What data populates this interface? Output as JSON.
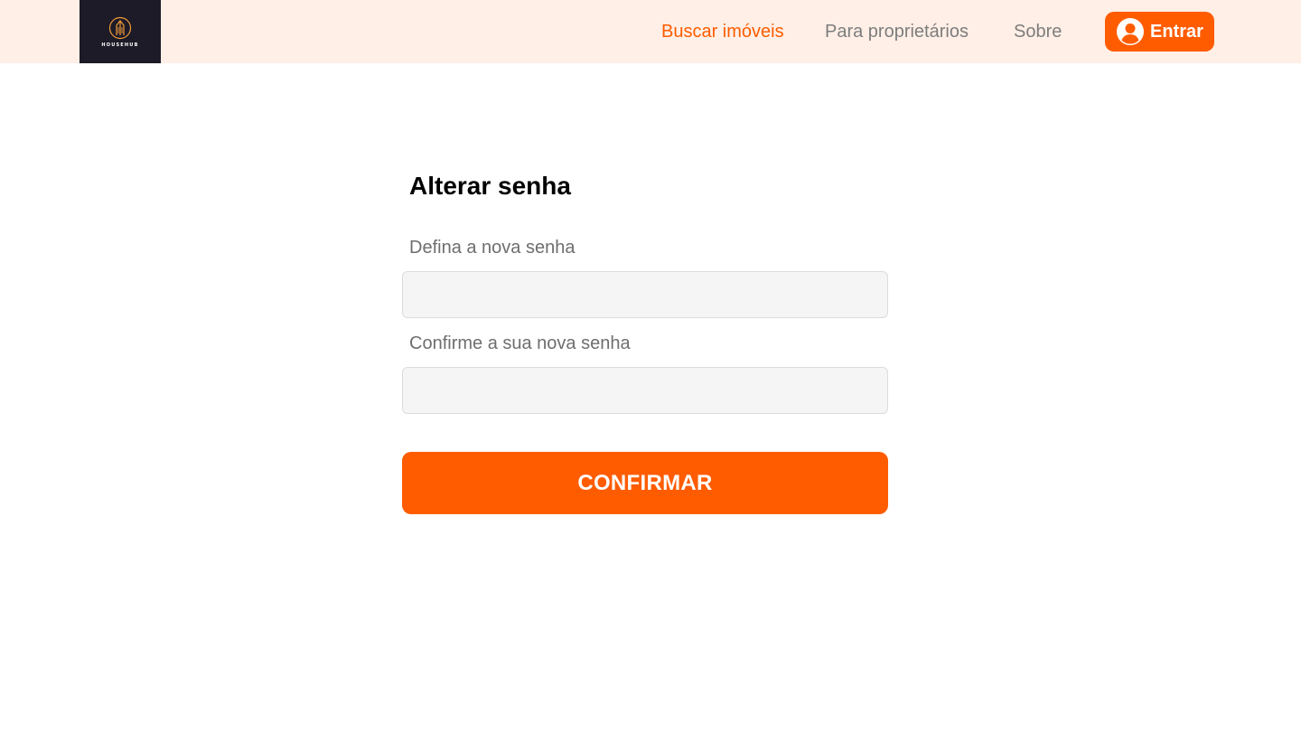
{
  "brand": {
    "logo_text": "HOUSEHUB",
    "logo_bg": "#1c1b27",
    "logo_accent": "#f29a3b"
  },
  "nav": {
    "items": [
      {
        "label": "Buscar imóveis",
        "active": true
      },
      {
        "label": "Para proprietários",
        "active": false
      },
      {
        "label": "Sobre",
        "active": false
      }
    ],
    "login_label": "Entrar",
    "login_icon": "user-circle-icon"
  },
  "form": {
    "title": "Alterar senha",
    "new_password_label": "Defina a nova senha",
    "new_password_value": "",
    "new_password_placeholder": "",
    "confirm_password_label": "Confirme a sua nova senha",
    "confirm_password_value": "",
    "confirm_password_placeholder": "",
    "submit_label": "CONFIRMAR"
  },
  "colors": {
    "accent": "#ff5c00",
    "header_bg": "#ffefe6",
    "nav_text": "#7d7d7d",
    "input_bg": "#f5f5f5"
  }
}
